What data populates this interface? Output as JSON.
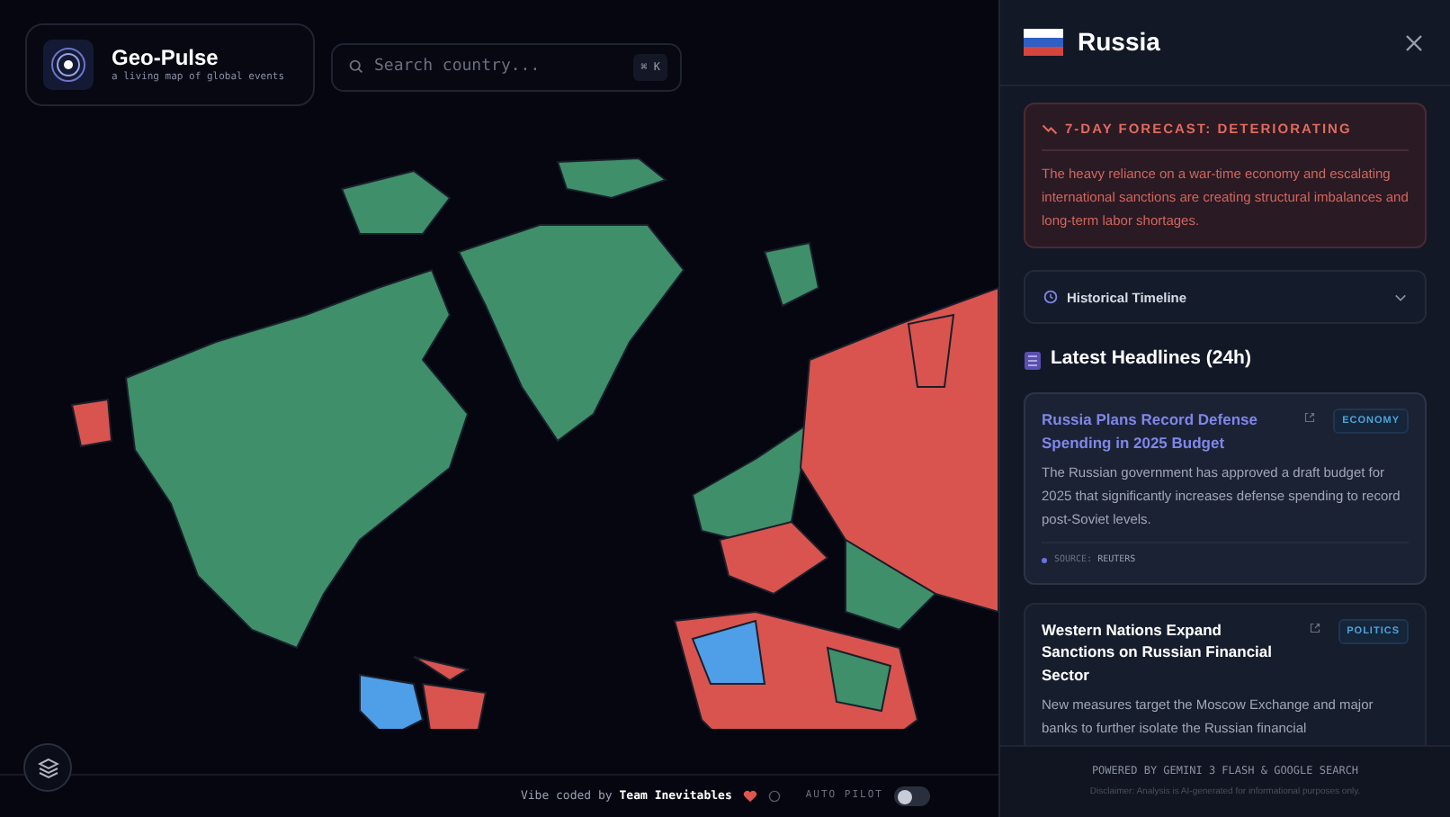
{
  "brand": {
    "title": "Geo-Pulse",
    "subtitle": "a living map of global events"
  },
  "search": {
    "placeholder": "Search country...",
    "shortcut": "⌘ K"
  },
  "footer": {
    "credit_prefix": "Vibe coded by",
    "credit_team": "Team Inevitables",
    "autopilot": {
      "label": "AUTO PILOT",
      "on": false
    }
  },
  "panel": {
    "country": "Russia",
    "forecast": {
      "title": "7-DAY FORECAST: DETERIORATING",
      "text": "The heavy reliance on a war-time economy and escalating international sanctions are creating structural imbalances and long-term labor shortages."
    },
    "timeline": {
      "label": "Historical Timeline",
      "expanded": false
    },
    "headlines_title": "Latest Headlines (24h)",
    "headlines": [
      {
        "title": "Russia Plans Record Defense Spending in 2025 Budget",
        "tag": "ECONOMY",
        "summary": "The Russian government has approved a draft budget for 2025 that significantly increases defense spending to record post-Soviet levels.",
        "source_label": "SOURCE:",
        "source": "REUTERS",
        "selected": true
      },
      {
        "title": "Western Nations Expand Sanctions on Russian Financial Sector",
        "tag": "POLITICS",
        "summary": "New measures target the Moscow Exchange and major banks to further isolate the Russian financial",
        "selected": false
      }
    ],
    "powered": "POWERED BY GEMINI 3 FLASH & GOOGLE SEARCH",
    "disclaimer": "Disclaimer: Analysis is AI-generated for informational purposes only."
  }
}
